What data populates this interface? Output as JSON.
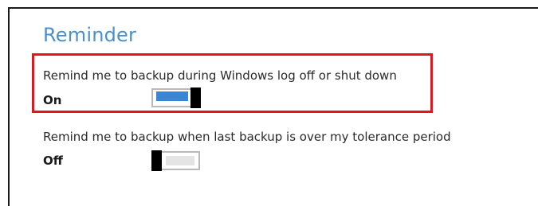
{
  "section": {
    "title": "Reminder"
  },
  "settings": [
    {
      "label": "Remind me to backup during Windows log off or shut down",
      "state_text": "On",
      "enabled": true,
      "highlighted": true
    },
    {
      "label": "Remind me to backup when last backup is over my tolerance period",
      "state_text": "Off",
      "enabled": false,
      "highlighted": false
    }
  ],
  "colors": {
    "title": "#4a90c9",
    "highlight_border": "#e8131b",
    "toggle_on_fill": "#3a86d6",
    "toggle_off_fill": "#e4e4e4",
    "toggle_knob": "#000000"
  }
}
